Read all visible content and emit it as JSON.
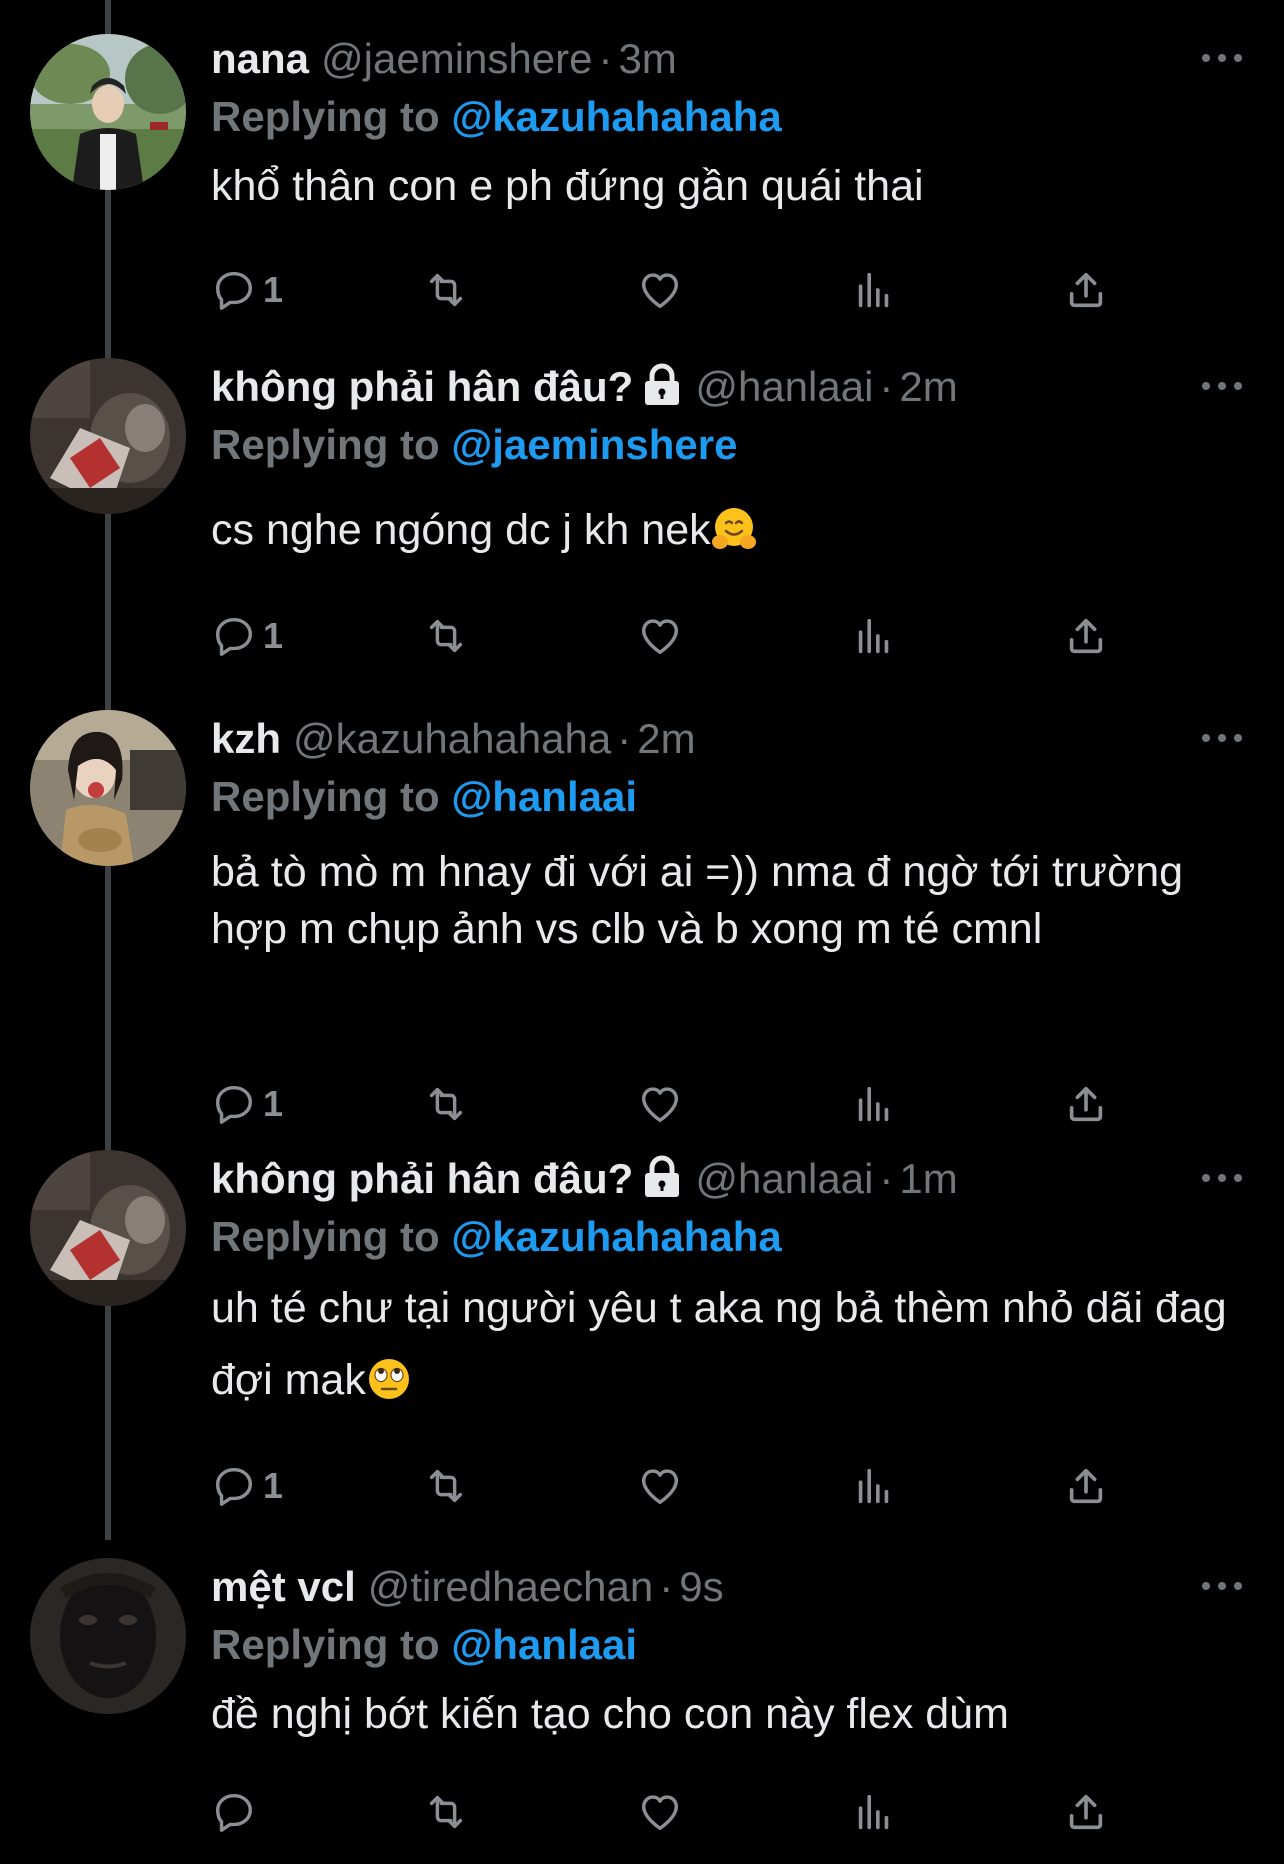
{
  "tweets": [
    {
      "display_name": "nana",
      "handle": "@jaeminshere",
      "separator": "·",
      "time": "3m",
      "locked": false,
      "replying_prefix": "Replying to",
      "replying_to": "@kazuhahahaha",
      "text": "khổ thân con e ph đứng gần quái thai",
      "text_emoji": "",
      "reply_count": "1",
      "avatar_icon": "person-photo-icon"
    },
    {
      "display_name": "không phải hân đâu?",
      "handle": "@hanlaai",
      "separator": "·",
      "time": "2m",
      "locked": true,
      "replying_prefix": "Replying to",
      "replying_to": "@jaeminshere",
      "text": "cs nghe ngóng dc j kh nek",
      "text_emoji": "hugging-face-emoji",
      "reply_count": "1",
      "avatar_icon": "person-photo-icon"
    },
    {
      "display_name": "kzh",
      "handle": "@kazuhahahaha",
      "separator": "·",
      "time": "2m",
      "locked": false,
      "replying_prefix": "Replying to",
      "replying_to": "@hanlaai",
      "text": "bả tò mò m hnay đi với ai =)) nma đ ngờ tới trường hợp m chụp ảnh vs clb và b xong m té cmnl",
      "text_emoji": "",
      "reply_count": "1",
      "avatar_icon": "person-photo-icon"
    },
    {
      "display_name": "không phải hân đâu?",
      "handle": "@hanlaai",
      "separator": "·",
      "time": "1m",
      "locked": true,
      "replying_prefix": "Replying to",
      "replying_to": "@kazuhahahaha",
      "text": "uh té chư tại người yêu t aka ng bả thèm nhỏ dãi đag đợi mak",
      "text_emoji": "eye-roll-emoji",
      "reply_count": "1",
      "avatar_icon": "person-photo-icon"
    },
    {
      "display_name": "mệt vcl",
      "handle": "@tiredhaechan",
      "separator": "·",
      "time": "9s",
      "locked": false,
      "replying_prefix": "Replying to",
      "replying_to": "@hanlaai",
      "text": "đề nghị bớt kiến tạo cho con này flex dùm",
      "text_emoji": "",
      "reply_count": "",
      "avatar_icon": "person-photo-icon"
    }
  ],
  "icons": {
    "reply": "reply-bubble-icon",
    "retweet": "retweet-icon",
    "like": "heart-icon",
    "views": "views-chart-icon",
    "share": "share-icon",
    "more": "more-dots-icon",
    "lock": "lock-icon"
  },
  "colors": {
    "background": "#000000",
    "text": "#e7e9ea",
    "muted": "#71767b",
    "accent": "#1d9bf0"
  }
}
